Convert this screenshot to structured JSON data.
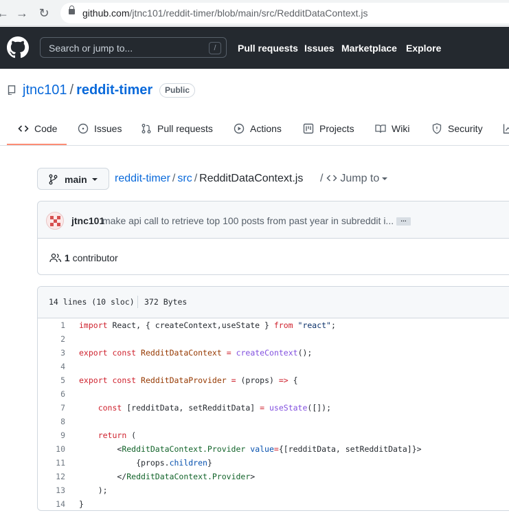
{
  "browser": {
    "url_host": "github.com",
    "url_path": "/jtnc101/reddit-timer/blob/main/src/RedditDataContext.js"
  },
  "header": {
    "search_placeholder": "Search or jump to...",
    "search_shortcut": "/",
    "nav": [
      "Pull requests",
      "Issues",
      "Marketplace",
      "Explore"
    ]
  },
  "repo": {
    "owner": "jtnc101",
    "separator": "/",
    "name": "reddit-timer",
    "visibility": "Public"
  },
  "tabs": [
    "Code",
    "Issues",
    "Pull requests",
    "Actions",
    "Projects",
    "Wiki",
    "Security"
  ],
  "breadcrumb": {
    "branch": "main",
    "repo": "reddit-timer",
    "dir": "src",
    "file": "RedditDataContext.js",
    "jump_to": "Jump to"
  },
  "commit": {
    "author": "jtnc101",
    "message": "make api call to retrieve top 100 posts from past year in subreddit i...",
    "ellipsis": "…",
    "contributor_count": "1",
    "contributor_label": "contributor"
  },
  "file": {
    "lines_info": "14 lines (10 sloc)",
    "size": "372 Bytes",
    "line_numbers": [
      "1",
      "2",
      "3",
      "4",
      "5",
      "6",
      "7",
      "8",
      "9",
      "10",
      "11",
      "12",
      "13",
      "14"
    ],
    "code": [
      "import React, { createContext,useState } from \"react\";",
      "",
      "export const RedditDataContext = createContext();",
      "",
      "export const RedditDataProvider = (props) => {",
      "",
      "    const [redditData, setRedditData] = useState([]);",
      "",
      "    return (",
      "        <RedditDataContext.Provider value={[redditData, setRedditData]}>",
      "            {props.children}",
      "        </RedditDataContext.Provider>",
      "    );",
      "}"
    ]
  },
  "colors": {
    "header_bg": "#24292f",
    "link": "#0969da",
    "tab_underline": "#fd8c73",
    "keyword": "#cf222e",
    "string": "#0a3069",
    "function": "#8250df"
  }
}
